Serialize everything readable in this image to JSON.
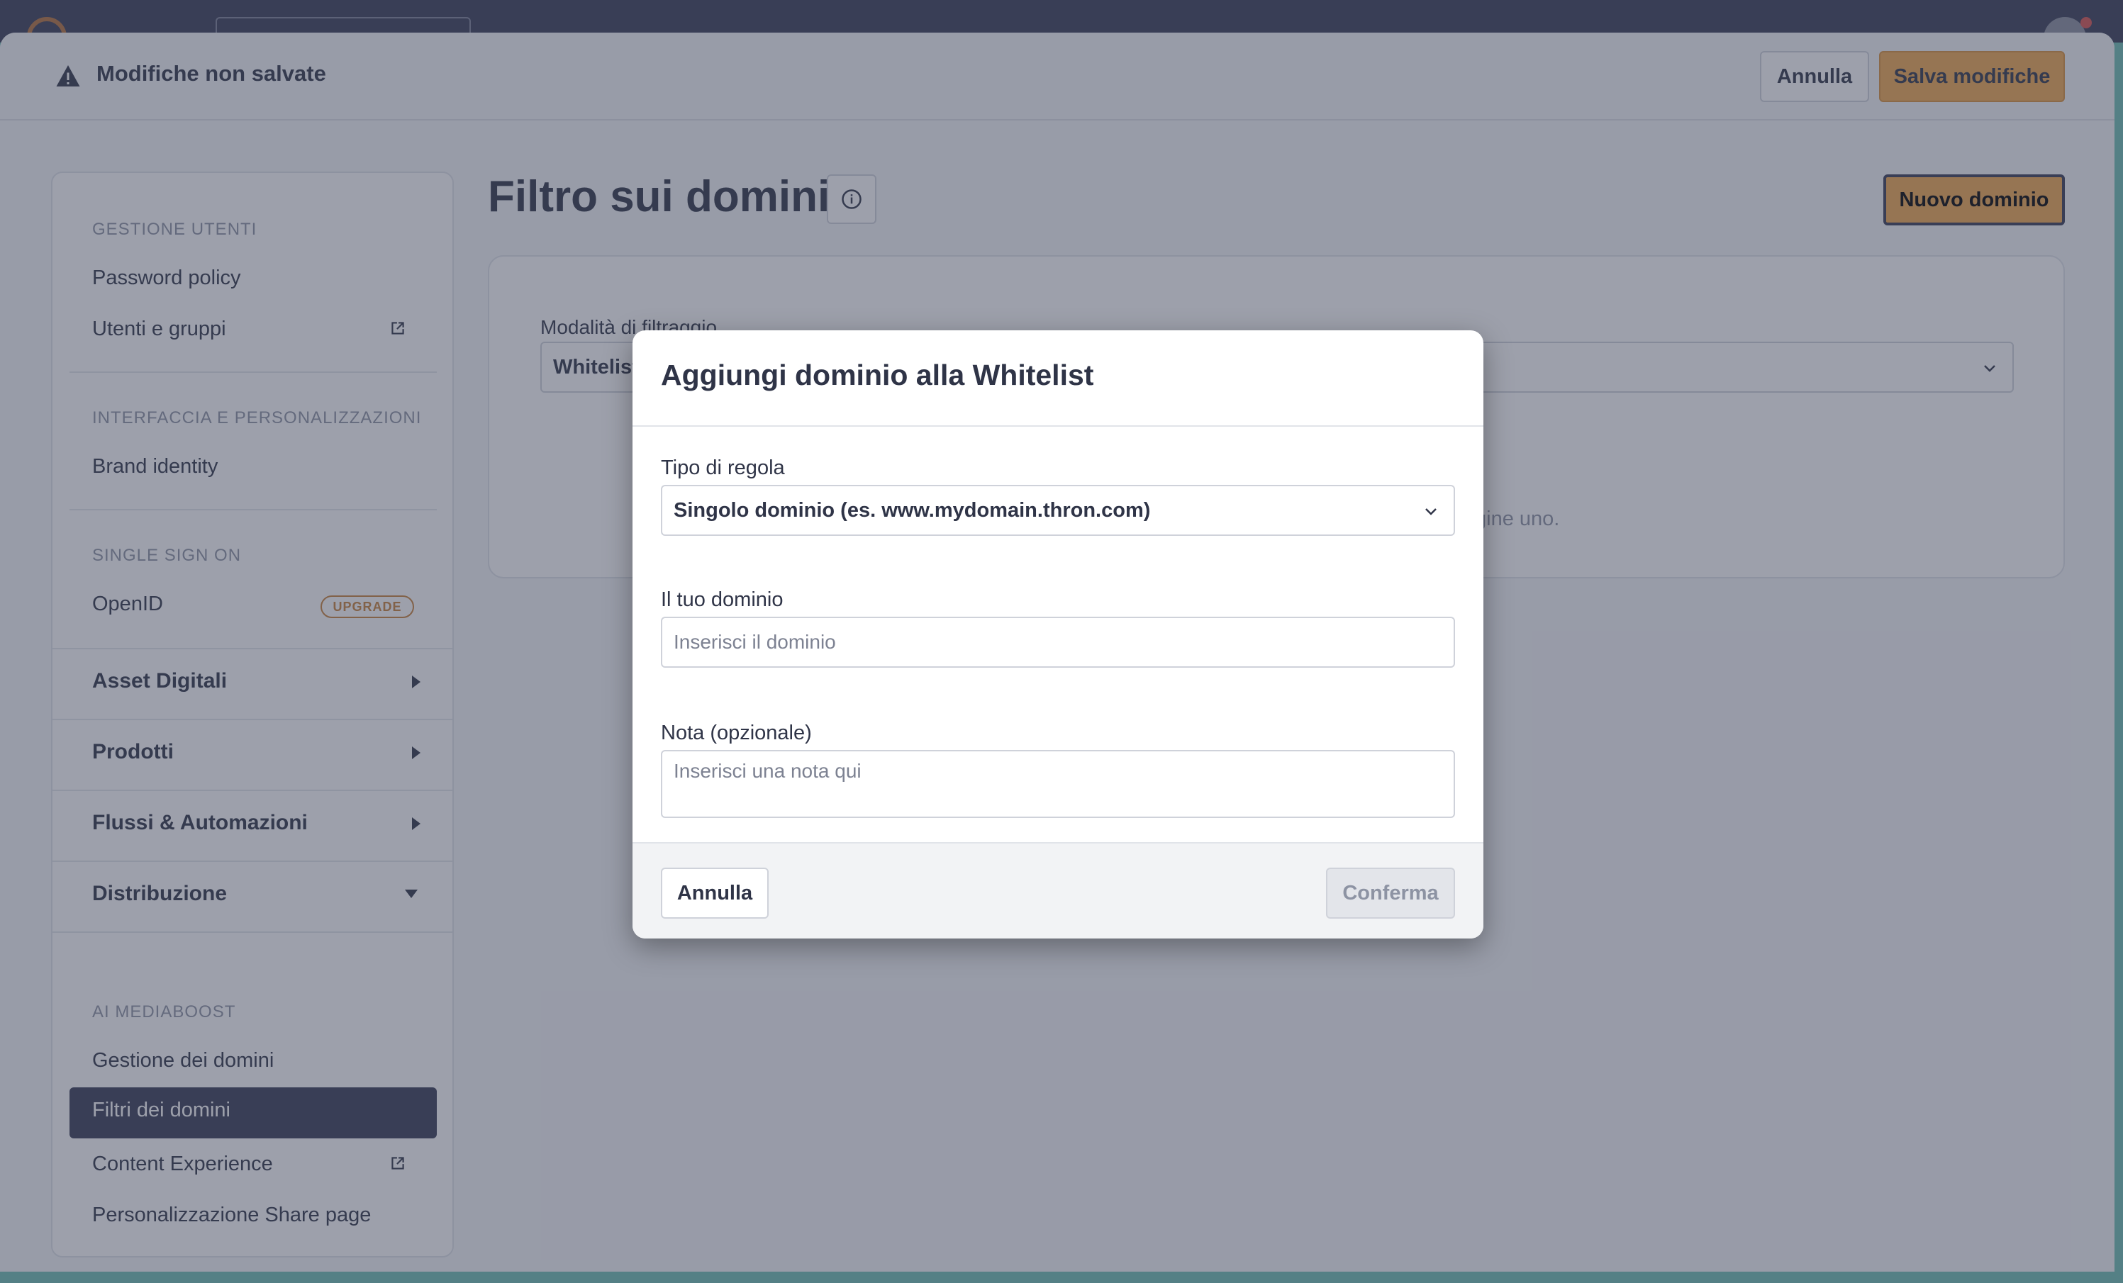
{
  "unsaved_bar": {
    "message": "Modifiche non salvate",
    "cancel_label": "Annulla",
    "save_label": "Salva modifiche"
  },
  "sidebar": {
    "sections": [
      {
        "label": "GESTIONE UTENTI",
        "items": [
          "Password policy",
          "Utenti e gruppi"
        ]
      },
      {
        "label": "INTERFACCIA E PERSONALIZZAZIONI",
        "items": [
          "Brand identity"
        ]
      },
      {
        "label": "SINGLE SIGN ON",
        "items": [
          "OpenID"
        ]
      }
    ],
    "upgrade_badge": "UPGRADE",
    "groups": [
      "Asset Digitali",
      "Prodotti",
      "Flussi & Automazioni",
      "Distribuzione"
    ],
    "ai_section": {
      "label": "AI MEDIABOOST",
      "items": [
        "Gestione dei domini",
        "Filtri dei domini",
        "Content Experience",
        "Personalizzazione Share page"
      ]
    }
  },
  "main": {
    "title": "Filtro sui domini",
    "new_button": "Nuovo dominio",
    "filter_label": "Modalità di filtraggio",
    "filter_value": "Whitelist",
    "empty_text": "gine uno."
  },
  "modal": {
    "title": "Aggiungi dominio alla Whitelist",
    "rule_type_label": "Tipo di regola",
    "rule_type_value": "Singolo dominio (es. www.mydomain.thron.com)",
    "domain_label": "Il tuo dominio",
    "domain_placeholder": "Inserisci il dominio",
    "note_label": "Nota (opzionale)",
    "note_placeholder": "Inserisci una nota qui",
    "cancel_label": "Annulla",
    "confirm_label": "Conferma"
  },
  "colors": {
    "primary": "#f0a94f",
    "nav_dark": "#363b55",
    "badge": "#c8823b"
  }
}
